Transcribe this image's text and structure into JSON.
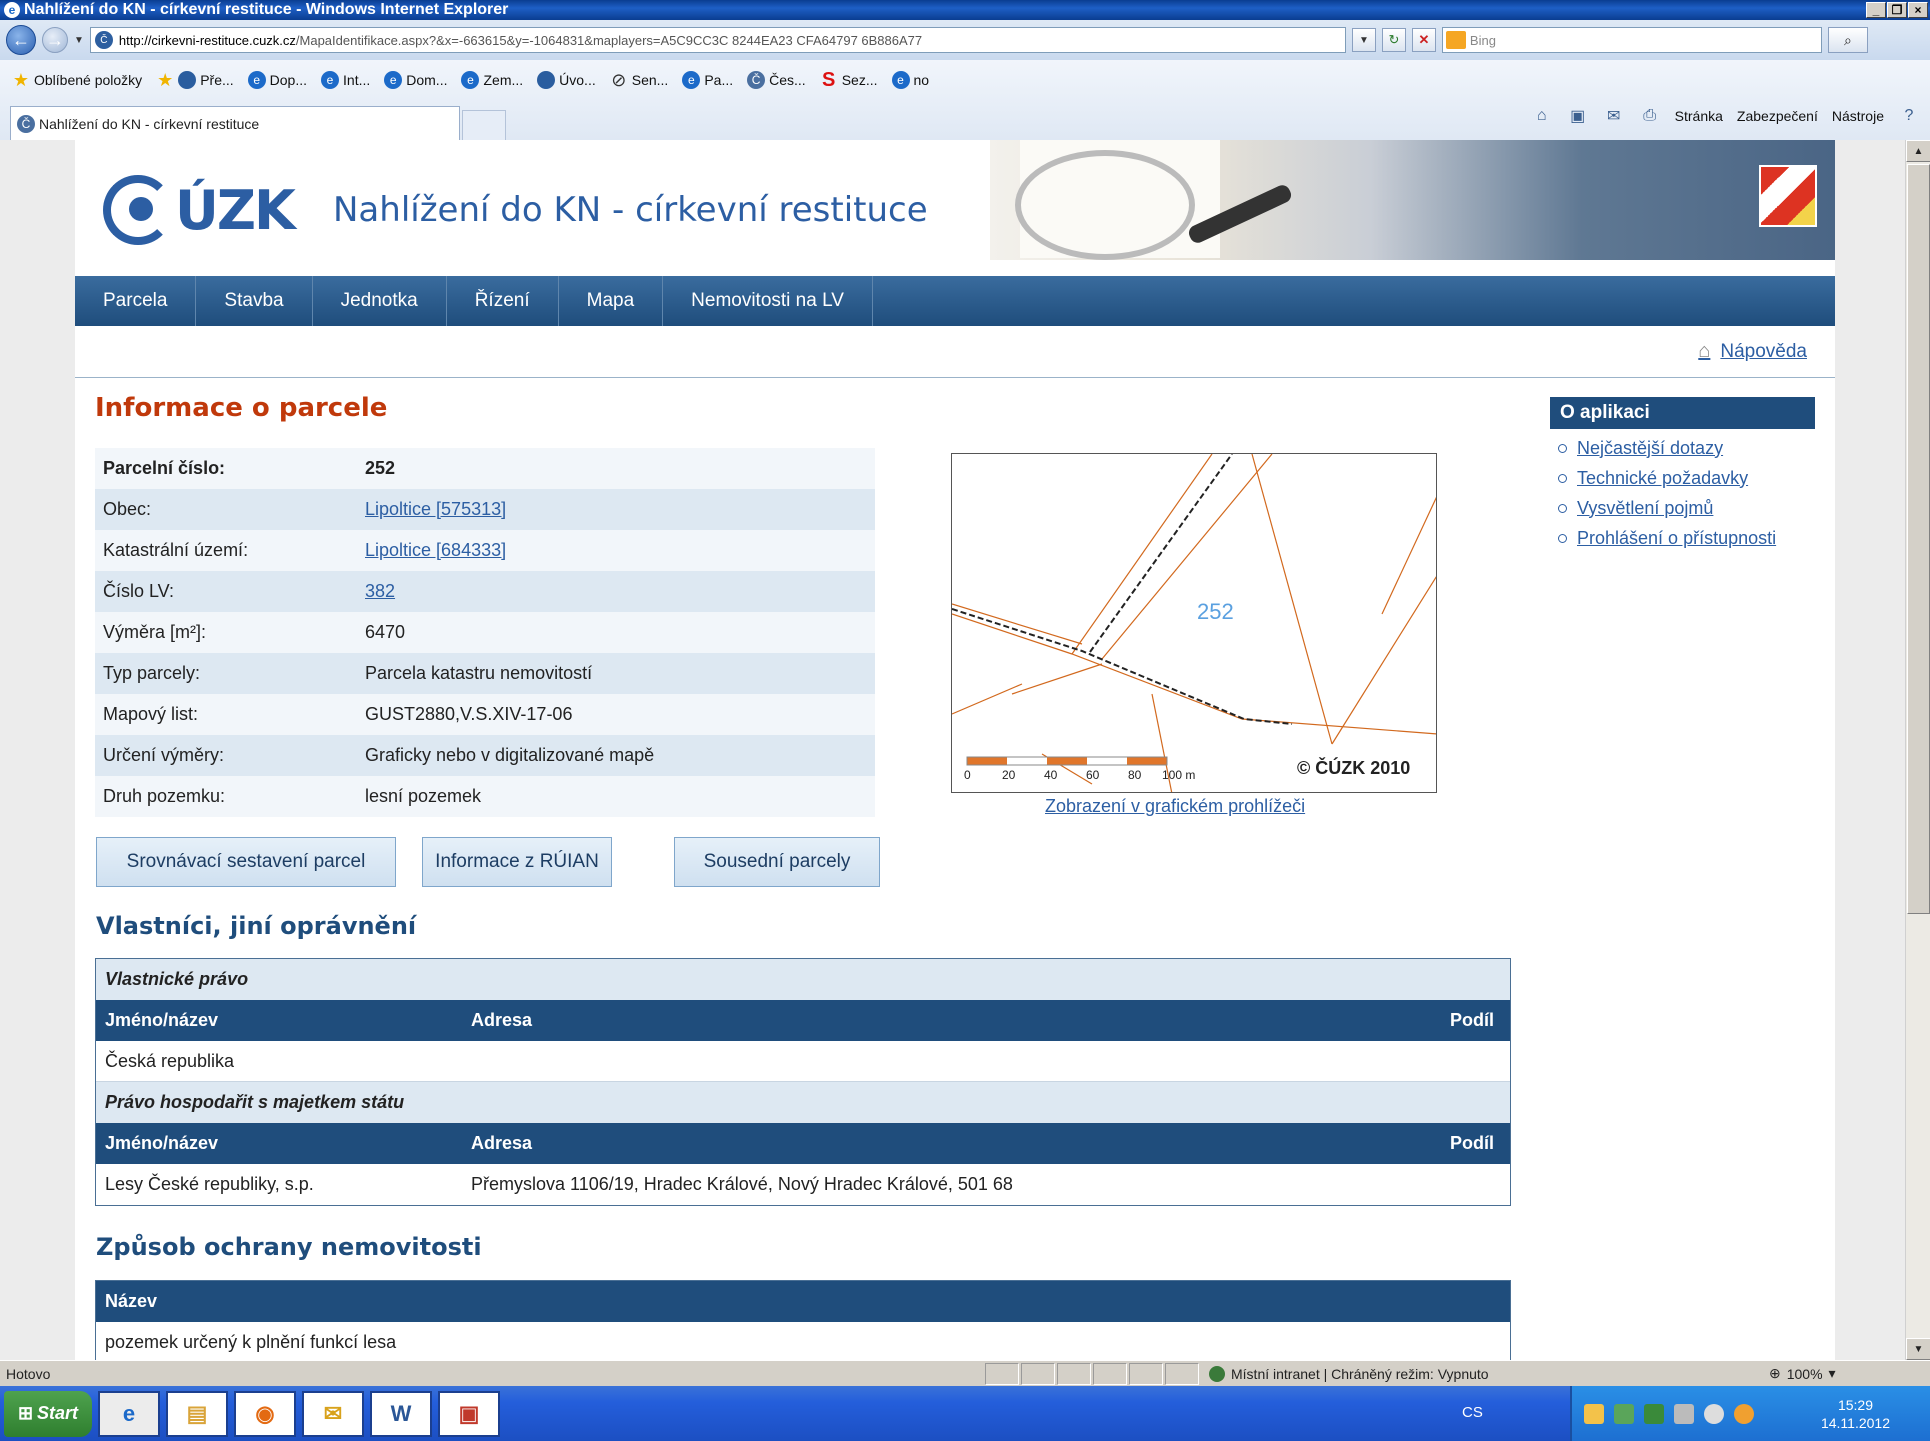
{
  "window": {
    "title": "Nahlížení do KN - církevní restituce - Windows Internet Explorer",
    "controls": [
      "_",
      "❐",
      "×"
    ]
  },
  "address": {
    "url_host": "http://cirkevni-restituce.cuzk.cz",
    "url_path": "/MapaIdentifikace.aspx?&x=-663615&y=-1064831&maplayers=A5C9CC3C 8244EA23 CFA64797 6B886A77",
    "search_placeholder": "Bing"
  },
  "favorites": {
    "label": "Oblíbené položky",
    "items": [
      "Pře...",
      "Dop...",
      "Int...",
      "Dom...",
      "Zem...",
      "Úvo...",
      "Sen...",
      "Pa...",
      "Čes...",
      "Sez...",
      "no"
    ]
  },
  "tab": {
    "title": "Nahlížení do KN - církevní restituce"
  },
  "commands": {
    "page": "Stránka",
    "security": "Zabezpečení",
    "tools": "Nástroje"
  },
  "header": {
    "logo": "ÚZK",
    "site_title": "Nahlížení do KN - církevní restituce"
  },
  "nav": [
    "Parcela",
    "Stavba",
    "Jednotka",
    "Řízení",
    "Mapa",
    "Nemovitosti na LV"
  ],
  "help": "Nápověda",
  "parcel": {
    "heading": "Informace o parcele",
    "rows": [
      {
        "key": "Parcelní číslo:",
        "value": "252"
      },
      {
        "key": "Obec:",
        "value": "Lipoltice [575313]"
      },
      {
        "key": "Katastrální území:",
        "value": "Lipoltice [684333]"
      },
      {
        "key": "Číslo LV:",
        "value": "382"
      },
      {
        "key": "Výměra [m²]:",
        "value": "6470"
      },
      {
        "key": "Typ parcely:",
        "value": "Parcela katastru nemovitostí"
      },
      {
        "key": "Mapový list:",
        "value": "GUST2880,V.S.XIV-17-06"
      },
      {
        "key": "Určení výměry:",
        "value": "Graficky nebo v digitalizované mapě"
      },
      {
        "key": "Druh pozemku:",
        "value": "lesní pozemek"
      }
    ]
  },
  "buttons": {
    "compare": "Srovnávací sestavení parcel",
    "ruian": "Informace z RÚIAN",
    "neighbors": "Sousední parcely"
  },
  "map": {
    "parcel_label": "252",
    "copyright": "© ČÚZK 2010",
    "scale": [
      "0",
      "20",
      "40",
      "60",
      "80",
      "100 m"
    ],
    "link": "Zobrazení v grafickém prohlížeči"
  },
  "sidebar": {
    "title": "O aplikaci",
    "links": [
      "Nejčastější dotazy",
      "Technické požadavky",
      "Vysvětlení pojmů",
      "Prohlášení o přístupnosti"
    ]
  },
  "owners": {
    "heading": "Vlastníci, jiní oprávnění",
    "sections": [
      {
        "title": "Vlastnické právo",
        "cols": [
          "Jméno/název",
          "Adresa",
          "Podíl"
        ],
        "row": [
          "Česká republika",
          "",
          ""
        ]
      },
      {
        "title": "Právo hospodařit s majetkem státu",
        "cols": [
          "Jméno/název",
          "Adresa",
          "Podíl"
        ],
        "row": [
          "Lesy České republiky, s.p.",
          "Přemyslova 1106/19, Hradec Králové, Nový Hradec Králové, 501 68",
          ""
        ]
      }
    ]
  },
  "protection": {
    "heading": "Způsob ochrany nemovitosti",
    "col": "Název",
    "row": "pozemek určený k plnění funkcí lesa"
  },
  "status": {
    "text": "Hotovo",
    "zone": "Místní intranet | Chráněný režim: Vypnuto",
    "zoom": "100%"
  },
  "taskbar": {
    "start": "Start",
    "lang": "CS",
    "time": "15:29",
    "date": "14.11.2012"
  }
}
